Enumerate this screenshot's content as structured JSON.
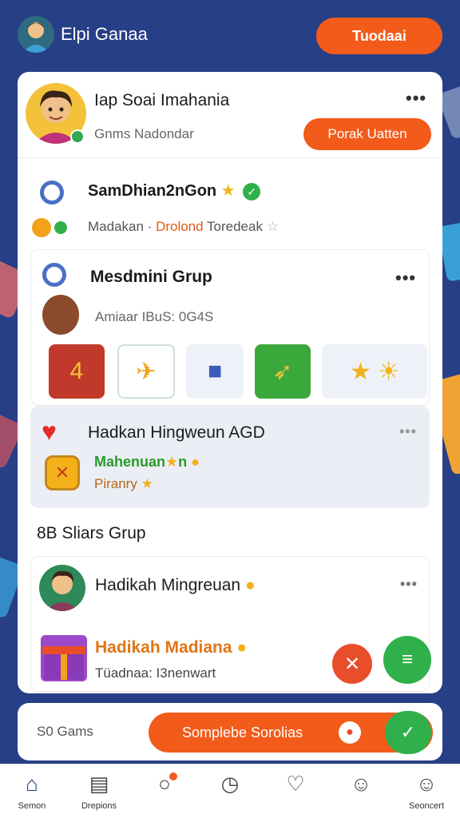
{
  "header": {
    "user_name": "Elpi Ganaa",
    "action_button": "Tuodaai"
  },
  "profile": {
    "title": "Iap Soai Imahania",
    "subtitle": "Gnms Nadondar",
    "button": "Porak Uatten"
  },
  "user_row": {
    "title": "SamDhian2nGon",
    "meta_prefix": "Madakan ·",
    "meta_highlight": "Drolond",
    "meta_suffix": "Toredeak"
  },
  "group": {
    "title": "Mesdmini Grup",
    "subtitle": "Amiaar IBuS: 0G4S",
    "items": [
      "book-item",
      "jet-item",
      "cube-item",
      "rocket-item",
      "wand-coin-item"
    ]
  },
  "favorite": {
    "title": "Hadkan Hingweun AGD",
    "line1": "Mahenuan",
    "line1_suffix": "n",
    "line2": "Piranry"
  },
  "section": {
    "heading": "8B Sliars Grup"
  },
  "member": {
    "name": "Hadikah Mingreuan",
    "gift_name": "Hadikah Madiana",
    "gift_sub": "Tüadnaa: I3nenwart"
  },
  "bottom_bar": {
    "left_label": "Gams",
    "left_prefix": "S0",
    "button_label": "Somplebe Sorolias"
  },
  "nav": {
    "items": [
      {
        "label": "Semon",
        "icon": "home-icon"
      },
      {
        "label": "Drepions",
        "icon": "news-icon"
      },
      {
        "label": "",
        "icon": "search-icon"
      },
      {
        "label": "",
        "icon": "clock-icon"
      },
      {
        "label": "",
        "icon": "heart-icon"
      },
      {
        "label": "",
        "icon": "user-icon"
      },
      {
        "label": "Seoncert",
        "icon": "profile-icon"
      }
    ]
  },
  "colors": {
    "background": "#263f86",
    "accent_orange": "#f25b1a",
    "accent_green": "#2fb04a"
  }
}
